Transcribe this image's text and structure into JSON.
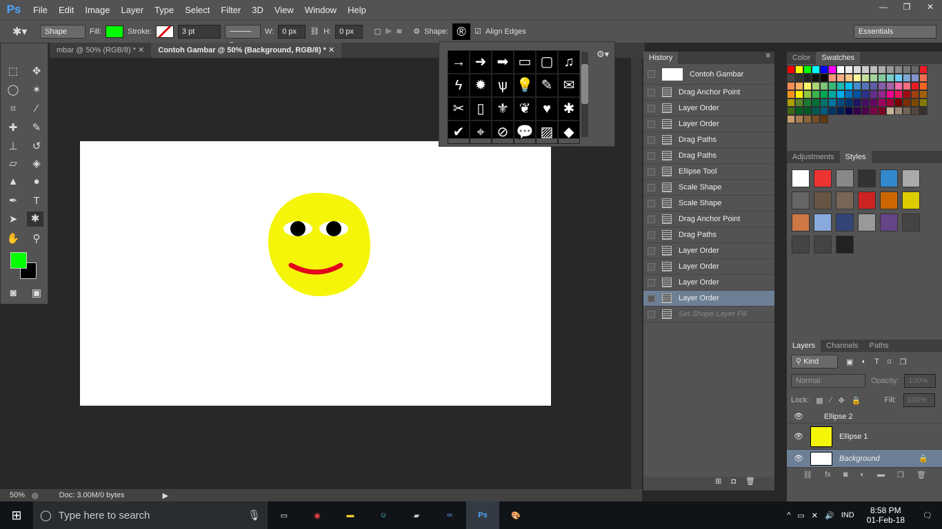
{
  "app": {
    "logo": "Ps",
    "menu": [
      "File",
      "Edit",
      "Image",
      "Layer",
      "Type",
      "Select",
      "Filter",
      "3D",
      "View",
      "Window",
      "Help"
    ],
    "window_controls": [
      "—",
      "❐",
      "✕"
    ]
  },
  "options": {
    "mode": "Shape",
    "fill_label": "Fill:",
    "fill_color": "#00ff00",
    "stroke_label": "Stroke:",
    "stroke_width": "3 pt",
    "w_label": "W:",
    "w_value": "0 px",
    "h_label": "H:",
    "h_value": "0 px",
    "shape_label": "Shape:",
    "shape_glyph": "®",
    "align_edges": "Align Edges",
    "workspace": "Essentials"
  },
  "tabs": [
    {
      "label": "mbar @ 50% (RGB/8) *"
    },
    {
      "label": "Contoh Gambar @ 50% (Background, RGB/8) *"
    }
  ],
  "shape_picker": {
    "shapes": [
      "→",
      "➜",
      "➡",
      "▭",
      "▢",
      "♫",
      "ϟ",
      "✹",
      "ѱ",
      "💡",
      "✎",
      "✉",
      "✂",
      "▯",
      "⚜",
      "❦",
      "♥",
      "✱",
      "✔",
      "⌖",
      "⊘",
      "💬",
      "▨",
      "◆"
    ]
  },
  "status": {
    "zoom": "50%",
    "doc": "Doc: 3.00M/0 bytes"
  },
  "history": {
    "title": "History",
    "snapshot": "Contoh Gambar",
    "items": [
      "Drag Anchor Point",
      "Layer Order",
      "Layer Order",
      "Drag Paths",
      "Drag Paths",
      "Ellipse Tool",
      "Scale Shape",
      "Scale Shape",
      "Drag Anchor Point",
      "Drag Paths",
      "Layer Order",
      "Layer Order",
      "Layer Order",
      "Layer Order",
      "Set Shape Layer Fill"
    ]
  },
  "color_panel": {
    "tabs": [
      "Color",
      "Swatches"
    ]
  },
  "swatch_colors": [
    "#ff0000",
    "#ffff00",
    "#00ff00",
    "#00ffff",
    "#0000ff",
    "#ff00ff",
    "#ffffff",
    "#eeeeee",
    "#dddddd",
    "#cccccc",
    "#bbbbbb",
    "#aaaaaa",
    "#999999",
    "#888888",
    "#777777",
    "#666666",
    "#ed1c24",
    "#444444",
    "#333333",
    "#222222",
    "#111111",
    "#000000",
    "#f7977a",
    "#fbad82",
    "#fdc68a",
    "#fff79a",
    "#c4df9b",
    "#a2d39c",
    "#82ca9d",
    "#7bcdc8",
    "#6ecff6",
    "#7ea7d8",
    "#8493ca",
    "#f26c4f",
    "#f68e55",
    "#fbaf5c",
    "#fff467",
    "#acd372",
    "#7cc576",
    "#3bb878",
    "#1abbb4",
    "#00bff3",
    "#438ccb",
    "#5574b9",
    "#605ca8",
    "#855fa8",
    "#a763a8",
    "#f06ea9",
    "#f26d7d",
    "#ed1c24",
    "#f26522",
    "#f7941d",
    "#fff200",
    "#8dc63f",
    "#39b54a",
    "#00a651",
    "#00a99d",
    "#00aeef",
    "#0072bc",
    "#0054a6",
    "#2e3192",
    "#662d91",
    "#92278f",
    "#ec008c",
    "#ed145b",
    "#9e0b0f",
    "#a0410d",
    "#a36209",
    "#aba000",
    "#598527",
    "#197b30",
    "#007236",
    "#00746b",
    "#0076a3",
    "#004b80",
    "#003471",
    "#1b1464",
    "#440e62",
    "#630460",
    "#9e005d",
    "#9e0039",
    "#790000",
    "#7b2e00",
    "#7d4900",
    "#827b00",
    "#406618",
    "#005e20",
    "#005826",
    "#005952",
    "#005b7f",
    "#003663",
    "#002157",
    "#0d004c",
    "#32004b",
    "#4b0049",
    "#7b0046",
    "#7a0026",
    "#c7b299",
    "#998675",
    "#736357",
    "#534741",
    "#37302d",
    "#c69c6d",
    "#a67c52",
    "#8c6239",
    "#754c24",
    "#603913"
  ],
  "adjust_panel": {
    "tabs": [
      "Adjustments",
      "Styles"
    ]
  },
  "style_colors": [
    "#ffffff",
    "#e33",
    "#888",
    "#333",
    "#38c",
    "#aaa",
    "#666",
    "#654",
    "#765",
    "#c22",
    "#c60",
    "#dc0",
    "#c74",
    "#8ad",
    "#347",
    "#999",
    "#648",
    "#444",
    "#444",
    "#444",
    "#222"
  ],
  "layers_panel": {
    "tabs": [
      "Layers",
      "Channels",
      "Paths"
    ],
    "filter": "Kind",
    "blend": "Normal",
    "opacity_label": "Opacity:",
    "opacity": "100%",
    "lock_label": "Lock:",
    "fill_label": "Fill:",
    "fill": "100%",
    "layers": [
      {
        "name": "Ellipse 2"
      },
      {
        "name": "Ellipse 1"
      },
      {
        "name": "Background"
      }
    ]
  },
  "taskbar": {
    "search": "Type here to search",
    "lang": "IND",
    "time": "8:58 PM",
    "date": "01-Feb-18"
  }
}
